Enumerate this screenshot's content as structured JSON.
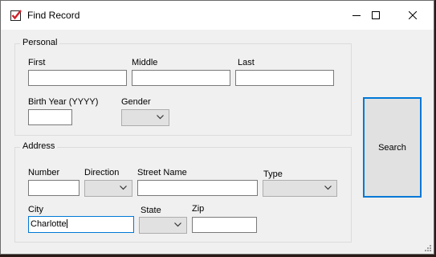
{
  "window": {
    "title": "Find Record",
    "icon": "checkbox-check-icon"
  },
  "personal": {
    "group_label": "Personal",
    "first_label": "First",
    "first_value": "",
    "middle_label": "Middle",
    "middle_value": "",
    "last_label": "Last",
    "last_value": "",
    "birth_year_label": "Birth Year (YYYY)",
    "birth_year_value": "",
    "gender_label": "Gender",
    "gender_value": ""
  },
  "address": {
    "group_label": "Address",
    "number_label": "Number",
    "number_value": "",
    "direction_label": "Direction",
    "direction_value": "",
    "street_label": "Street Name",
    "street_value": "",
    "type_label": "Type",
    "type_value": "",
    "city_label": "City",
    "city_value": "Charlotte",
    "state_label": "State",
    "state_value": "",
    "zip_label": "Zip",
    "zip_value": ""
  },
  "search_button": {
    "label": "Search"
  },
  "colors": {
    "accent": "#0078d7",
    "icon_red": "#d0202a"
  }
}
